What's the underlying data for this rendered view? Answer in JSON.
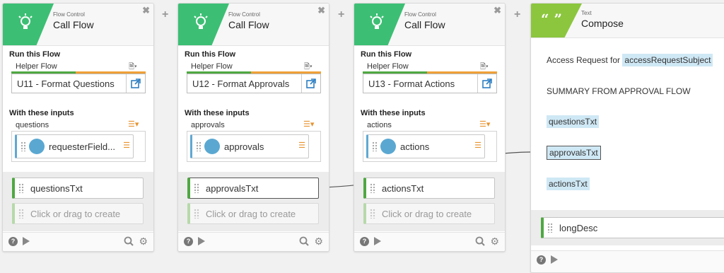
{
  "cards": [
    {
      "category": "Flow Control",
      "name": "Call Flow",
      "run_label": "Run this Flow",
      "helper_label": "Helper Flow",
      "flow_value": "U11 - Format Questions",
      "inputs_label": "With these inputs",
      "input_name": "questions",
      "input_chip": "requesterField...",
      "output_var": "questionsTxt",
      "create_placeholder": "Click or drag to create"
    },
    {
      "category": "Flow Control",
      "name": "Call Flow",
      "run_label": "Run this Flow",
      "helper_label": "Helper Flow",
      "flow_value": "U12 - Format Approvals",
      "inputs_label": "With these inputs",
      "input_name": "approvals",
      "input_chip": "approvals",
      "output_var": "approvalsTxt",
      "create_placeholder": "Click or drag to create"
    },
    {
      "category": "Flow Control",
      "name": "Call Flow",
      "run_label": "Run this Flow",
      "helper_label": "Helper Flow",
      "flow_value": "U13 - Format Actions",
      "inputs_label": "With these inputs",
      "input_name": "actions",
      "input_chip": "actions",
      "output_var": "actionsTxt",
      "create_placeholder": "Click or drag to create"
    }
  ],
  "compose": {
    "category": "Text",
    "name": "Compose",
    "line1_prefix": "Access Request for",
    "line1_pill": "accessRequestSubject",
    "summary": "SUMMARY FROM APPROVAL FLOW",
    "pill_questions": "questionsTxt",
    "pill_approvals": "approvalsTxt",
    "pill_actions": "actionsTxt",
    "output_var": "longDesc",
    "quote_icon": "“ ”"
  },
  "icons": {
    "bulb": "lightbulb-icon",
    "close": "close-icon",
    "db": "database-icon",
    "link": "external-link-icon",
    "list": "list-icon",
    "help": "help-icon",
    "play": "play-icon",
    "search": "search-icon",
    "gear": "gear-icon",
    "plus": "plus-icon"
  },
  "colors": {
    "flow_green": "#3cbf74",
    "text_green": "#8cc63e",
    "chip_blue": "#5aa8d2",
    "accent_orange": "#e8932f",
    "pill_bg": "#cfe8f5"
  }
}
